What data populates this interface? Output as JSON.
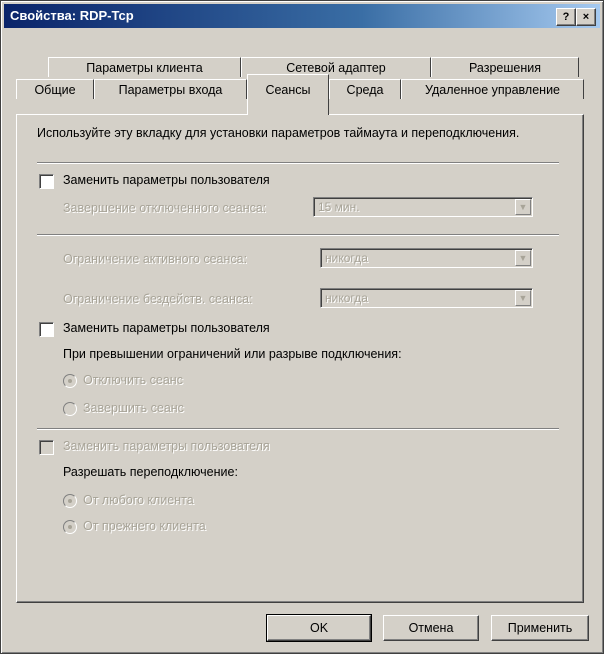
{
  "window": {
    "title": "Свойства: RDP-Tcp",
    "help_label": "?",
    "close_label": "×"
  },
  "tabs_row1": [
    "Параметры клиента",
    "Сетевой адаптер",
    "Разрешения"
  ],
  "tabs_row2": [
    "Общие",
    "Параметры входа",
    "Сеансы",
    "Среда",
    "Удаленное управление"
  ],
  "active_tab": "Сеансы",
  "panel": {
    "description": "Используйте эту вкладку для установки параметров таймаута и переподключения.",
    "section1": {
      "override_label": "Заменить параметры пользователя",
      "end_disconnected_label": "Завершение отключенного сеанса:",
      "end_disconnected_value": "15 мин."
    },
    "section2": {
      "active_limit_label": "Ограничение активного сеанса:",
      "active_limit_value": "никогда",
      "idle_limit_label": "Ограничение бездейств. сеанса:",
      "idle_limit_value": "никогда",
      "override_label": "Заменить параметры пользователя",
      "on_limit_label": "При превышении ограничений или разрыве подключения:",
      "opt_disconnect": "Отключить сеанс",
      "opt_end": "Завершить сеанс"
    },
    "section3": {
      "override_label": "Заменить параметры пользователя",
      "allow_reconnect_label": "Разрешать переподключение:",
      "opt_any_client": "От любого клиента",
      "opt_prev_client": "От прежнего клиента"
    }
  },
  "buttons": {
    "ok": "OK",
    "cancel": "Отмена",
    "apply": "Применить"
  }
}
